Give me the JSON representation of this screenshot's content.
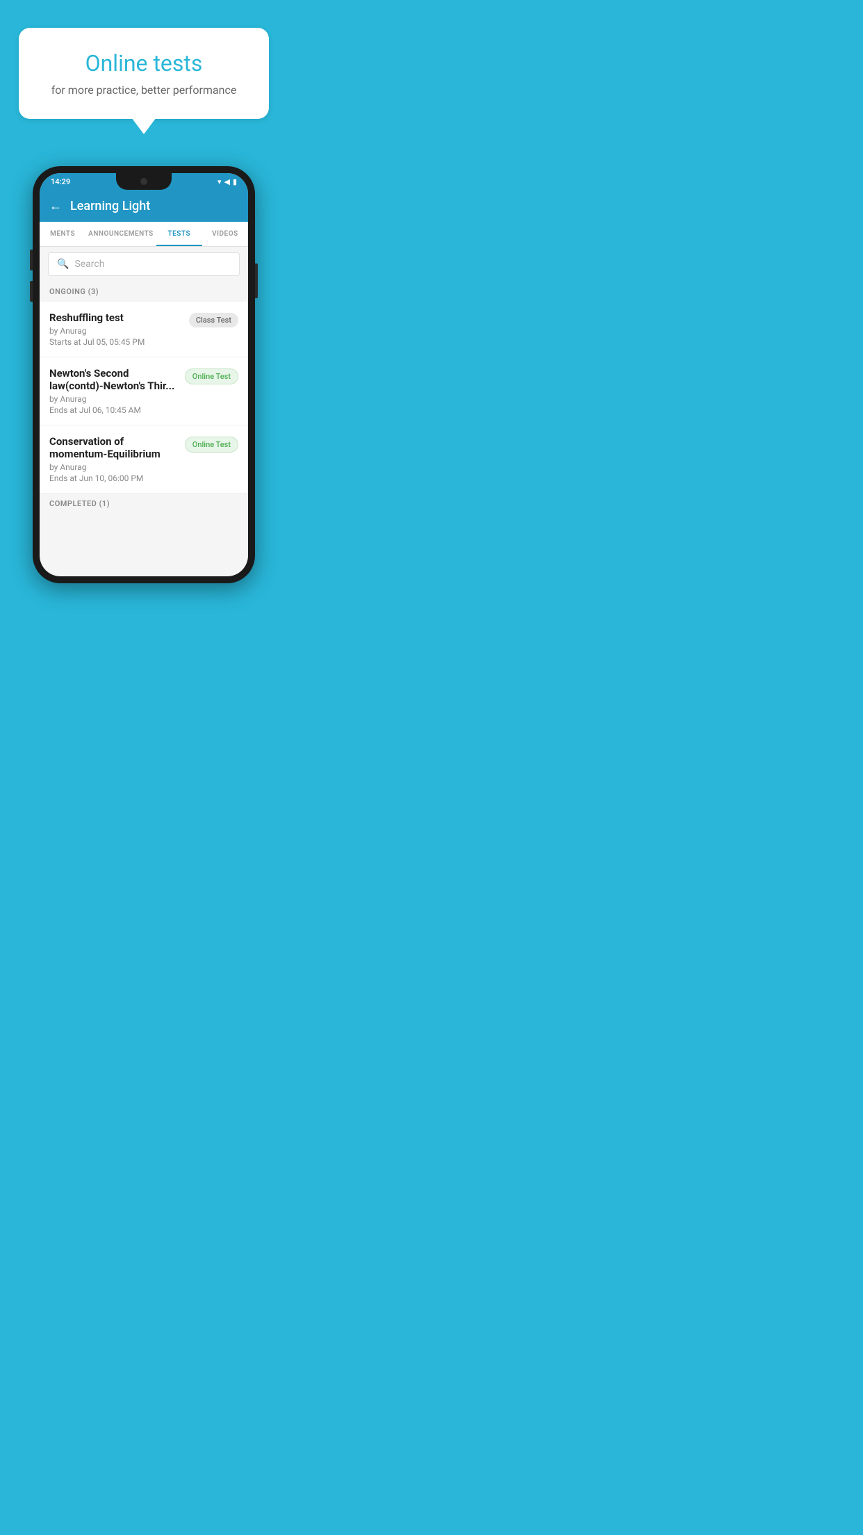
{
  "background_color": "#29b6d8",
  "promo": {
    "title": "Online tests",
    "subtitle": "for more practice, better performance"
  },
  "status_bar": {
    "time": "14:29",
    "icons": "▼◀▮"
  },
  "app_bar": {
    "back_label": "←",
    "title": "Learning Light"
  },
  "tabs": [
    {
      "label": "MENTS",
      "active": false
    },
    {
      "label": "ANNOUNCEMENTS",
      "active": false
    },
    {
      "label": "TESTS",
      "active": true
    },
    {
      "label": "VIDEOS",
      "active": false
    }
  ],
  "search": {
    "placeholder": "Search"
  },
  "ongoing_section": {
    "label": "ONGOING (3)"
  },
  "ongoing_tests": [
    {
      "name": "Reshuffling test",
      "author": "by Anurag",
      "date": "Starts at  Jul 05, 05:45 PM",
      "badge": "Class Test",
      "badge_type": "class"
    },
    {
      "name": "Newton's Second law(contd)-Newton's Thir...",
      "author": "by Anurag",
      "date": "Ends at  Jul 06, 10:45 AM",
      "badge": "Online Test",
      "badge_type": "online"
    },
    {
      "name": "Conservation of momentum-Equilibrium",
      "author": "by Anurag",
      "date": "Ends at  Jun 10, 06:00 PM",
      "badge": "Online Test",
      "badge_type": "online"
    }
  ],
  "completed_section": {
    "label": "COMPLETED (1)"
  }
}
